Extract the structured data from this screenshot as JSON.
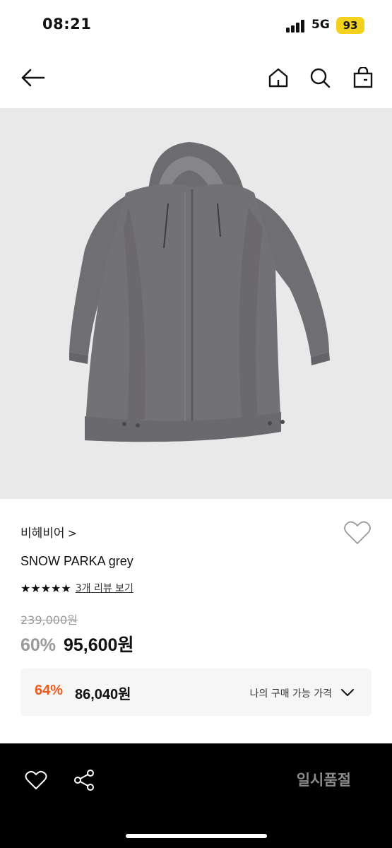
{
  "status_bar": {
    "time": "08:21",
    "network": "5G",
    "battery": "93"
  },
  "nav": {
    "back_icon": "arrow-left-icon",
    "home_icon": "home-icon",
    "search_icon": "search-icon",
    "cart_icon": "shopping-bag-icon"
  },
  "product": {
    "brand": "비헤비어",
    "brand_chevron": ">",
    "name": "SNOW PARKA grey",
    "stars": "★★★★★",
    "rating": 5,
    "review_link": "3개 리뷰 보기",
    "original_price": "239,000원",
    "discount_rate": "60%",
    "sale_price": "95,600원"
  },
  "my_price": {
    "rate": "64%",
    "amount": "86,040원",
    "label": "나의 구매 가능 가격"
  },
  "bottom_bar": {
    "wish_icon": "heart-icon",
    "share_icon": "share-icon",
    "status_button": "일시품절"
  },
  "colors": {
    "accent_orange": "#f05a1f",
    "bottom_bar_bg": "#000000",
    "battery_yellow": "#f2d21e"
  }
}
